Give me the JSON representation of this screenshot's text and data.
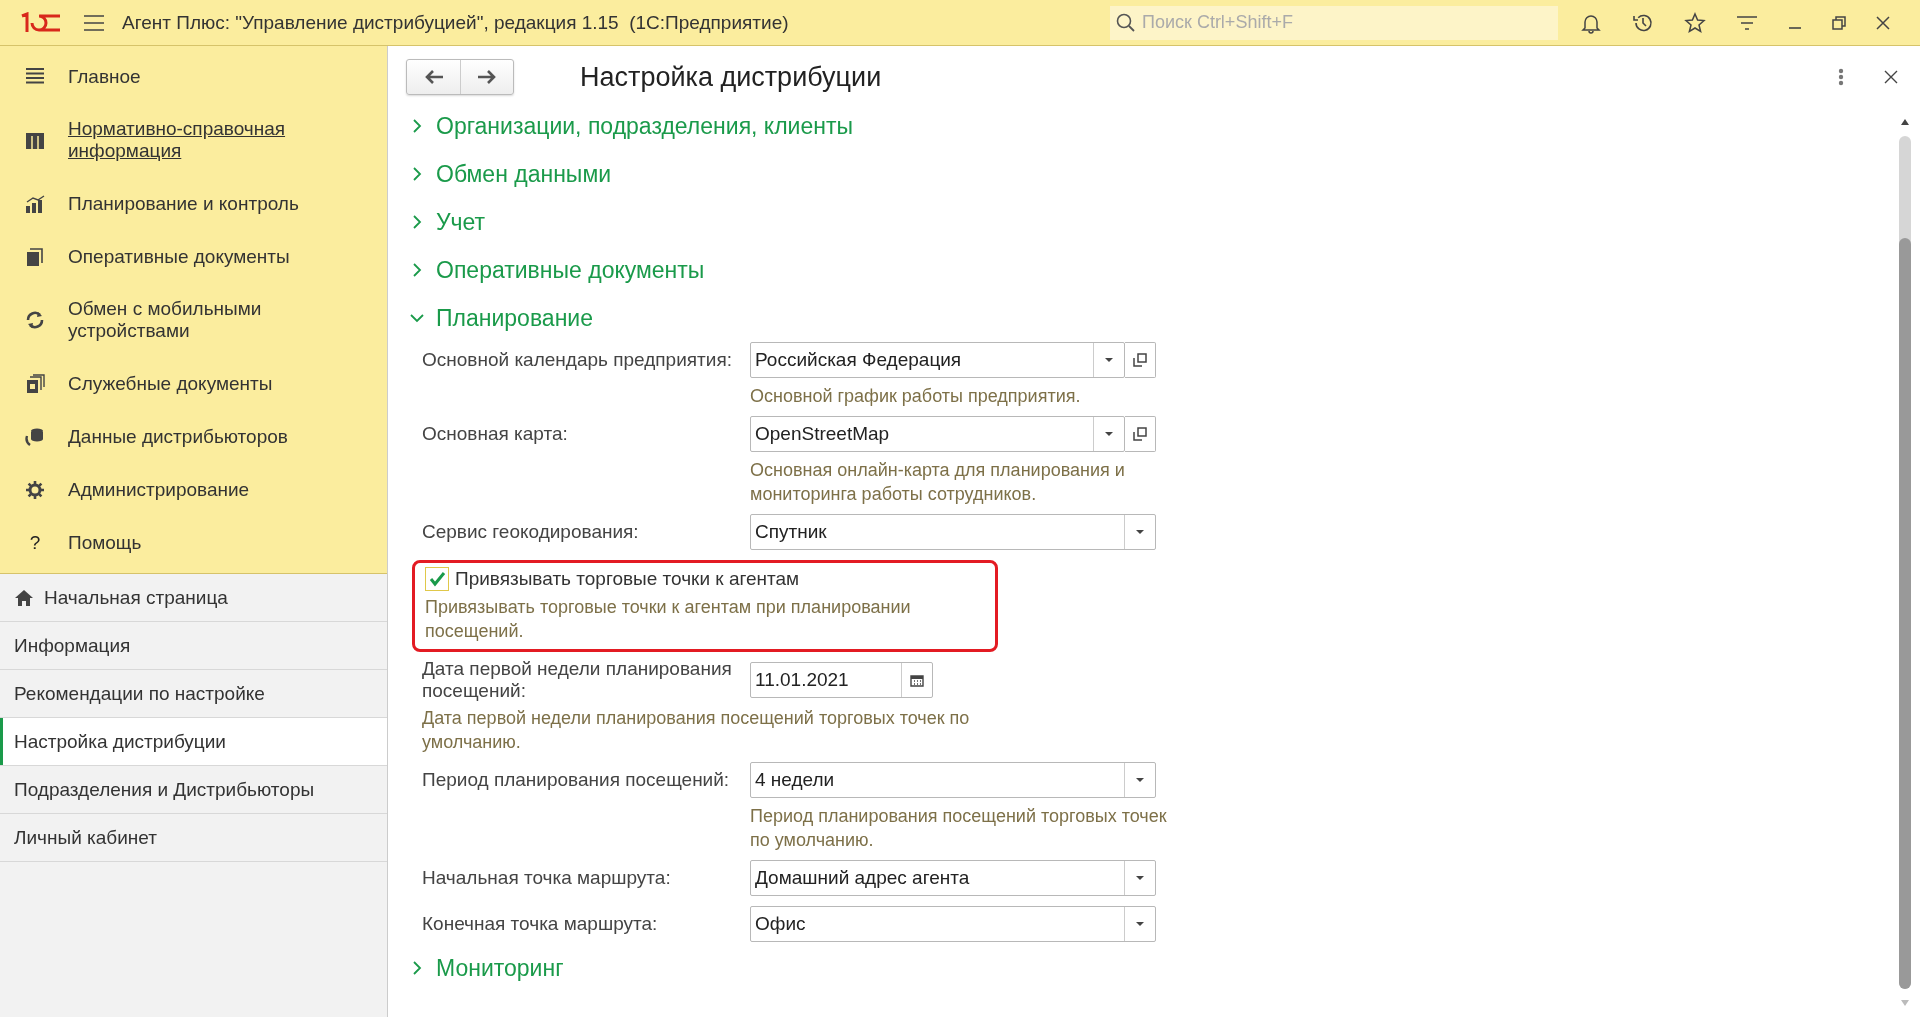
{
  "app_bar": {
    "title": "Агент Плюс: \"Управление дистрибуцией\", редакция 1.15  (1С:Предприятие)",
    "search": {
      "placeholder": "Поиск Ctrl+Shift+F"
    }
  },
  "main_menu": [
    {
      "label": "Главное",
      "hovered": false
    },
    {
      "label": "Нормативно-справочная информация",
      "hovered": true
    },
    {
      "label": "Планирование и контроль",
      "hovered": false
    },
    {
      "label": "Оперативные документы",
      "hovered": false
    },
    {
      "label": "Обмен с мобильными устройствами",
      "hovered": false
    },
    {
      "label": "Служебные документы",
      "hovered": false
    },
    {
      "label": "Данные дистрибьюторов",
      "hovered": false
    },
    {
      "label": "Администрирование",
      "hovered": false
    },
    {
      "label": "Помощь",
      "hovered": false,
      "glyph": "?"
    }
  ],
  "open_pages": [
    {
      "label": "Начальная страница",
      "kind": "home",
      "selected": false
    },
    {
      "label": "Информация",
      "kind": "page",
      "selected": false
    },
    {
      "label": "Рекомендации по настройке",
      "kind": "page",
      "selected": false
    },
    {
      "label": "Настройка дистрибуции",
      "kind": "page",
      "selected": true
    },
    {
      "label": "Подразделения и Дистрибьюторы",
      "kind": "page",
      "selected": false
    },
    {
      "label": "Личный кабинет",
      "kind": "page",
      "selected": false
    }
  ],
  "form": {
    "title": "Настройка дистрибуции",
    "sections": [
      {
        "title": "Организации, подразделения, клиенты",
        "expanded": false
      },
      {
        "title": "Обмен данными",
        "expanded": false
      },
      {
        "title": "Учет",
        "expanded": false
      },
      {
        "title": "Оперативные документы",
        "expanded": false
      },
      {
        "title": "Планирование",
        "expanded": true,
        "fields": [
          {
            "kind": "select",
            "label": "Основной календарь предприятия:",
            "value": "Российская Федерация",
            "open_button": true,
            "hint": "Основной график работы предприятия."
          },
          {
            "kind": "select",
            "label": "Основная карта:",
            "value": "OpenStreetMap",
            "open_button": true,
            "hint": "Основная онлайн-карта для планирования и мониторинга работы сотрудников."
          },
          {
            "kind": "select",
            "label": "Сервис геокодирования:",
            "value": "Спутник",
            "open_button": false
          },
          {
            "kind": "checkbox",
            "label": "Привязывать торговые точки к агентам",
            "checked": true,
            "highlighted": true,
            "hint": "Привязывать торговые точки к агентам при планировании посещений."
          },
          {
            "kind": "date",
            "label": "Дата первой недели планирования посещений:",
            "value": "11.01.2021",
            "hint": "Дата первой недели планирования посещений торговых точек по умолчанию."
          },
          {
            "kind": "select",
            "label": "Период планирования посещений:",
            "value": "4 недели",
            "open_button": false,
            "hint": "Период планирования посещений торговых точек по умолчанию."
          },
          {
            "kind": "select",
            "label": "Начальная точка маршрута:",
            "value": "Домашний адрес агента",
            "open_button": false
          },
          {
            "kind": "select",
            "label": "Конечная точка маршрута:",
            "value": "Офис",
            "open_button": false
          }
        ]
      },
      {
        "title": "Мониторинг",
        "expanded": false
      }
    ]
  }
}
